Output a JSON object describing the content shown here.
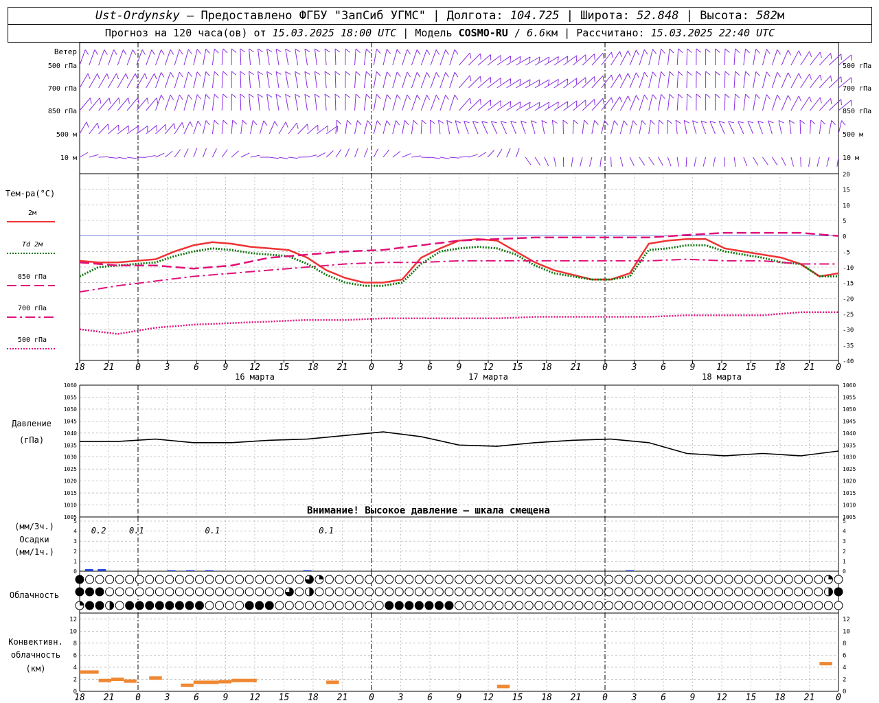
{
  "header": {
    "station": "Ust-Ordynsky",
    "dash": " — ",
    "provided_by": "Предоставлено ФГБУ \"ЗапСиб УГМС\"",
    "lon_label": "Долгота:",
    "lon_value": "104.725",
    "lat_label": "Широта:",
    "lat_value": "52.848",
    "alt_label": "Высота:",
    "alt_value": "582",
    "alt_unit": "м",
    "sep": " | ",
    "forecast_label": "Прогноз на 120 часа(ов) от",
    "forecast_start": "15.03.2025 18:00 UTC",
    "model_label": "Модель",
    "model_name": "COSMO-RU",
    "model_res": "6.6",
    "model_res_unit": "км",
    "calc_label": "Рассчитано:",
    "calc_time": "15.03.2025 22:40 UTC"
  },
  "colors": {
    "wind": "#8a2be2",
    "t2m": "#ee3333",
    "td2m": "#117711",
    "t850": "#e0107a",
    "t700": "#e0107a",
    "t500": "#e0107a",
    "pressure": "#000000",
    "precip": "#1f3fd8",
    "convective": "#ee8833",
    "grid": "#a0a0a0",
    "zero_line": "#3344cc"
  },
  "time_axis": {
    "hour_ticks": [
      "18",
      "21",
      "0",
      "3",
      "6",
      "9",
      "12",
      "15",
      "18",
      "21",
      "0",
      "3",
      "6",
      "9",
      "12",
      "15",
      "18",
      "21",
      "0",
      "3",
      "6",
      "9",
      "12",
      "15",
      "18",
      "21",
      "0"
    ],
    "day_labels": [
      {
        "hour_index": 6,
        "label": "16 марта"
      },
      {
        "hour_index": 14,
        "label": "17 марта"
      },
      {
        "hour_index": 22,
        "label": "18 марта"
      }
    ],
    "midnight_indices": [
      2,
      10,
      18
    ]
  },
  "wind_panel": {
    "title": "Ветер",
    "levels": [
      "500 гПа",
      "700 гПа",
      "850 гПа",
      "500 м",
      "10 м"
    ]
  },
  "chart_data": [
    {
      "type": "line",
      "title": "Тем-ра(°С)",
      "ylim": [
        -40,
        20
      ],
      "yticks": [
        20,
        15,
        10,
        5,
        0,
        -5,
        -10,
        -15,
        -20,
        -25,
        -30,
        -35,
        -40
      ],
      "x_unit": "hours since 15.03.2025 18:00 UTC",
      "series": [
        {
          "name": "2м",
          "style": "solid",
          "x": [
            0,
            3,
            6,
            9,
            12,
            15,
            18,
            21,
            24,
            27,
            30,
            33,
            36,
            39,
            42,
            45,
            48,
            51,
            54,
            57,
            60,
            63,
            66,
            69,
            72,
            75,
            78,
            81,
            84,
            87,
            90,
            93,
            96,
            99,
            102,
            105,
            108,
            111,
            114,
            117,
            120
          ],
          "values": [
            -8,
            -8.5,
            -8.5,
            -8,
            -7.5,
            -5,
            -3,
            -2,
            -2.5,
            -3.5,
            -4,
            -4.5,
            -7,
            -11,
            -13.5,
            -15,
            -15,
            -14,
            -7,
            -4,
            -1.5,
            -1,
            -1.5,
            -5,
            -8.5,
            -11,
            -12.5,
            -14,
            -14,
            -12,
            -2.5,
            -1.5,
            -1,
            -1,
            -4,
            -5,
            -6,
            -7,
            -9,
            -13,
            -12
          ]
        },
        {
          "name": "Td 2м",
          "style": "dotted",
          "x": [
            0,
            3,
            6,
            9,
            12,
            15,
            18,
            21,
            24,
            27,
            30,
            33,
            36,
            39,
            42,
            45,
            48,
            51,
            54,
            57,
            60,
            63,
            66,
            69,
            72,
            75,
            78,
            81,
            84,
            87,
            90,
            93,
            96,
            99,
            102,
            105,
            108,
            111,
            114,
            117,
            120
          ],
          "values": [
            -13,
            -10,
            -9.5,
            -9,
            -8.5,
            -6.5,
            -5,
            -4,
            -4.5,
            -5.5,
            -6,
            -6.5,
            -9,
            -12.5,
            -15,
            -16,
            -16,
            -15,
            -9,
            -5,
            -4,
            -3.5,
            -4,
            -6,
            -9.5,
            -12,
            -13,
            -14,
            -14,
            -13,
            -4.5,
            -4,
            -3,
            -3,
            -5,
            -6,
            -7,
            -8.5,
            -9,
            -13,
            -13
          ]
        },
        {
          "name": "850 гПа",
          "style": "dashed",
          "x": [
            0,
            6,
            12,
            18,
            24,
            30,
            36,
            42,
            48,
            54,
            60,
            66,
            72,
            78,
            84,
            90,
            96,
            102,
            108,
            114,
            120
          ],
          "values": [
            -8.5,
            -9.5,
            -9.5,
            -10.5,
            -9.5,
            -7,
            -6,
            -5,
            -4.5,
            -3,
            -1.5,
            -1,
            -0.5,
            -0.5,
            -0.5,
            -0.5,
            0.3,
            1,
            1,
            1,
            0
          ]
        },
        {
          "name": "700 гПа",
          "style": "dashdot",
          "x": [
            0,
            6,
            12,
            18,
            24,
            30,
            36,
            42,
            48,
            54,
            60,
            66,
            72,
            78,
            84,
            90,
            96,
            102,
            108,
            114,
            120
          ],
          "values": [
            -18,
            -16,
            -14.5,
            -13,
            -12,
            -11,
            -10,
            -9,
            -8.5,
            -8.5,
            -8,
            -8,
            -8,
            -8,
            -8,
            -8,
            -7.5,
            -8,
            -8,
            -9,
            -9
          ]
        },
        {
          "name": "500 гПа",
          "style": "fine-dotted",
          "x": [
            0,
            6,
            12,
            18,
            24,
            30,
            36,
            42,
            48,
            54,
            60,
            66,
            72,
            78,
            84,
            90,
            96,
            102,
            108,
            114,
            120
          ],
          "values": [
            -30,
            -31.5,
            -29.5,
            -28.5,
            -28,
            -27.5,
            -27,
            -27,
            -26.5,
            -26.5,
            -26.5,
            -26.5,
            -26,
            -26,
            -26,
            -26,
            -25.5,
            -25.5,
            -25.5,
            -24.5,
            -24.5
          ]
        }
      ]
    },
    {
      "type": "line",
      "title": "Давление",
      "unit_label": "(гПа)",
      "ylim": [
        1005,
        1060
      ],
      "yticks": [
        1060,
        1055,
        1050,
        1045,
        1040,
        1035,
        1030,
        1025,
        1020,
        1015,
        1010,
        1005
      ],
      "warning": "Внимание! Высокое давление — шкала смещена",
      "series": [
        {
          "name": "Давление",
          "x": [
            0,
            6,
            12,
            18,
            24,
            30,
            36,
            42,
            48,
            54,
            60,
            66,
            72,
            78,
            84,
            90,
            96,
            102,
            108,
            114,
            120
          ],
          "values": [
            1036.5,
            1036.5,
            1037.5,
            1036,
            1036,
            1037,
            1037.5,
            1039,
            1040.5,
            1038.5,
            1035,
            1034.5,
            1036,
            1037,
            1037.5,
            1036,
            1031.5,
            1030.5,
            1031.5,
            1030.5,
            1032.5
          ]
        }
      ]
    },
    {
      "type": "bar",
      "title": "Осадки",
      "units_label_3h": "(мм/3ч.)",
      "units_label_1h": "(мм/1ч.)",
      "ylim": [
        0,
        5
      ],
      "yticks": [
        5,
        4,
        3,
        2,
        1,
        0
      ],
      "annotations": [
        {
          "x": 3,
          "label": "0.2"
        },
        {
          "x": 9,
          "label": "0.1"
        },
        {
          "x": 21,
          "label": "0.1"
        },
        {
          "x": 39,
          "label": "0.1"
        }
      ],
      "bars": [
        {
          "x": 1.5,
          "value": 0.2
        },
        {
          "x": 3.5,
          "value": 0.2
        },
        {
          "x": 14.5,
          "value": 0.1
        },
        {
          "x": 17.5,
          "value": 0.1
        },
        {
          "x": 20.5,
          "value": 0.1
        },
        {
          "x": 36,
          "value": 0.1
        },
        {
          "x": 87,
          "value": 0.1
        }
      ]
    },
    {
      "type": "table",
      "title": "Облачность",
      "rows": [
        "high",
        "mid",
        "low"
      ],
      "cover_fraction": {
        "high": [
          1,
          0.75,
          0,
          0,
          0,
          0,
          0,
          0,
          0,
          0,
          0,
          0,
          0,
          0,
          0,
          0,
          0,
          0,
          0,
          0,
          0,
          0,
          0,
          0,
          0,
          0,
          0,
          0,
          0,
          0,
          0,
          0,
          0,
          0,
          0,
          0,
          0,
          0,
          0,
          0,
          0,
          0,
          0,
          0,
          0,
          0,
          0,
          0,
          0,
          0,
          0,
          0,
          0,
          0,
          0,
          0,
          0.5,
          0,
          0,
          0,
          0.75,
          0,
          0.5,
          0.25,
          0.5,
          0,
          0,
          0,
          0,
          0,
          0,
          0,
          0,
          0,
          0,
          0,
          0,
          0,
          0,
          0,
          0,
          0,
          0,
          0,
          0,
          0,
          0,
          0,
          0,
          0,
          0,
          0,
          0,
          0,
          0,
          0,
          0,
          0,
          0,
          0,
          0,
          0,
          0,
          0,
          0,
          0,
          0,
          0,
          0,
          0,
          0,
          0,
          0,
          0,
          0,
          0,
          0,
          0,
          0,
          0,
          0,
          0,
          0,
          0,
          0,
          0,
          0,
          0,
          0,
          0,
          0,
          0,
          0,
          0,
          0,
          0,
          0,
          0,
          0,
          0,
          0,
          0,
          0,
          0,
          0,
          0,
          0,
          0,
          0,
          0,
          0,
          0,
          0,
          0,
          0,
          0,
          0,
          0,
          0,
          0,
          0,
          0,
          0,
          0,
          0,
          0,
          0,
          0,
          0,
          0,
          0,
          0,
          0,
          0,
          0,
          0,
          0,
          0,
          0,
          0,
          0,
          0,
          0,
          0,
          0,
          0,
          0,
          0,
          0,
          0,
          0,
          0,
          0,
          0,
          0,
          0.75,
          0.25,
          0.5,
          0,
          0
        ],
        "mid": [
          1,
          1,
          1,
          1,
          1,
          1,
          0.25,
          0,
          0,
          0,
          0,
          0,
          0,
          0,
          0,
          0,
          0,
          0,
          0,
          0,
          0,
          0,
          0,
          0,
          0,
          0,
          0,
          0,
          0,
          0,
          0,
          0,
          0,
          0,
          0,
          0,
          0,
          0,
          0,
          0,
          0,
          0,
          0,
          0,
          0,
          0,
          0,
          0,
          0,
          0,
          0,
          0,
          0,
          0,
          0,
          0,
          0.75,
          0,
          0,
          0,
          0,
          0.5,
          0.25,
          0.75,
          0,
          0,
          0,
          0,
          0,
          0,
          0,
          0,
          0,
          0,
          0,
          0,
          0,
          0,
          0,
          0,
          0,
          0,
          0,
          0,
          0,
          0,
          0,
          0,
          0,
          0,
          0,
          0,
          0,
          0,
          0,
          0,
          0,
          0,
          0,
          0,
          0,
          0,
          0,
          0,
          0,
          0,
          0,
          0,
          0,
          0,
          0,
          0,
          0,
          0,
          0,
          0,
          0,
          0,
          0,
          0,
          0,
          0,
          0,
          0,
          0,
          0,
          0,
          0,
          0,
          0,
          0,
          0,
          0,
          0,
          0,
          0,
          0,
          0,
          0,
          0,
          0,
          0,
          0,
          0,
          0,
          0,
          0,
          0,
          0,
          0,
          0,
          0,
          0,
          0,
          0,
          0,
          0,
          0,
          0,
          0,
          0,
          0,
          0,
          0,
          0,
          0,
          0,
          0,
          0,
          0,
          0,
          0,
          0,
          0,
          0,
          0,
          0,
          0,
          0,
          0,
          0,
          0,
          0,
          0,
          0,
          0,
          0,
          0,
          0,
          0,
          0,
          0,
          0,
          0,
          0,
          0,
          0,
          0,
          0,
          0.75,
          0.5,
          1,
          1,
          1
        ],
        "low": [
          0.25,
          1,
          1,
          1,
          1,
          1,
          1,
          1,
          0.5,
          0.25,
          0,
          0,
          1,
          1,
          1,
          1,
          1,
          1,
          1,
          1,
          1,
          1,
          1,
          1,
          1,
          1,
          1,
          1,
          1,
          1,
          1,
          1,
          0,
          0,
          0,
          0,
          0,
          0,
          0,
          0,
          0,
          0,
          0,
          0,
          1,
          1,
          1,
          1,
          1,
          1,
          1,
          0,
          0,
          0,
          0,
          0,
          0,
          0,
          0,
          0,
          0,
          0,
          0,
          0,
          0,
          0,
          0,
          0,
          0,
          0,
          0,
          0,
          0,
          0,
          0,
          0,
          0,
          0,
          0,
          0,
          1,
          1,
          1,
          1,
          1,
          1,
          1,
          1,
          1,
          1,
          1,
          1,
          1,
          1,
          1,
          1,
          1,
          1,
          0,
          0,
          0,
          0,
          0,
          0,
          0,
          0,
          0,
          0,
          0,
          0,
          0,
          0,
          0,
          0,
          0,
          0,
          0,
          0,
          0,
          0,
          0,
          0,
          0,
          0,
          0,
          0,
          0,
          0,
          0,
          0,
          0,
          0,
          0,
          0,
          0,
          0,
          0,
          0,
          0,
          0,
          0,
          0,
          0,
          0,
          0,
          0,
          0,
          0,
          0,
          0,
          0,
          0,
          0,
          0,
          0,
          0,
          0,
          0,
          0,
          0,
          0,
          0,
          0,
          0,
          0,
          0,
          0,
          0,
          0,
          0,
          0,
          0,
          0,
          0,
          0,
          0,
          0,
          0,
          0,
          0,
          0,
          0,
          0,
          0,
          0,
          0,
          0,
          0,
          0,
          0,
          0,
          0,
          0,
          0,
          0,
          0,
          0,
          0,
          0.25,
          0
        ]
      }
    },
    {
      "type": "bar",
      "title": "Конвективн. облачность",
      "unit_label": "(км)",
      "ylim": [
        0,
        13
      ],
      "yticks": [
        12,
        10,
        8,
        6,
        4,
        2,
        0
      ],
      "segments": [
        {
          "x0": 0,
          "x1": 3,
          "value": 3.2
        },
        {
          "x0": 3,
          "x1": 5,
          "value": 1.8
        },
        {
          "x0": 5,
          "x1": 7,
          "value": 2.0
        },
        {
          "x0": 7,
          "x1": 9,
          "value": 1.7
        },
        {
          "x0": 11,
          "x1": 13,
          "value": 2.2
        },
        {
          "x0": 16,
          "x1": 18,
          "value": 1.0
        },
        {
          "x0": 18,
          "x1": 22,
          "value": 1.5
        },
        {
          "x0": 22,
          "x1": 24,
          "value": 1.6
        },
        {
          "x0": 24,
          "x1": 26,
          "value": 1.8
        },
        {
          "x0": 26,
          "x1": 28,
          "value": 1.8
        },
        {
          "x0": 39,
          "x1": 41,
          "value": 1.5
        },
        {
          "x0": 66,
          "x1": 68,
          "value": 0.8
        },
        {
          "x0": 117,
          "x1": 119,
          "value": 4.6
        }
      ]
    }
  ]
}
